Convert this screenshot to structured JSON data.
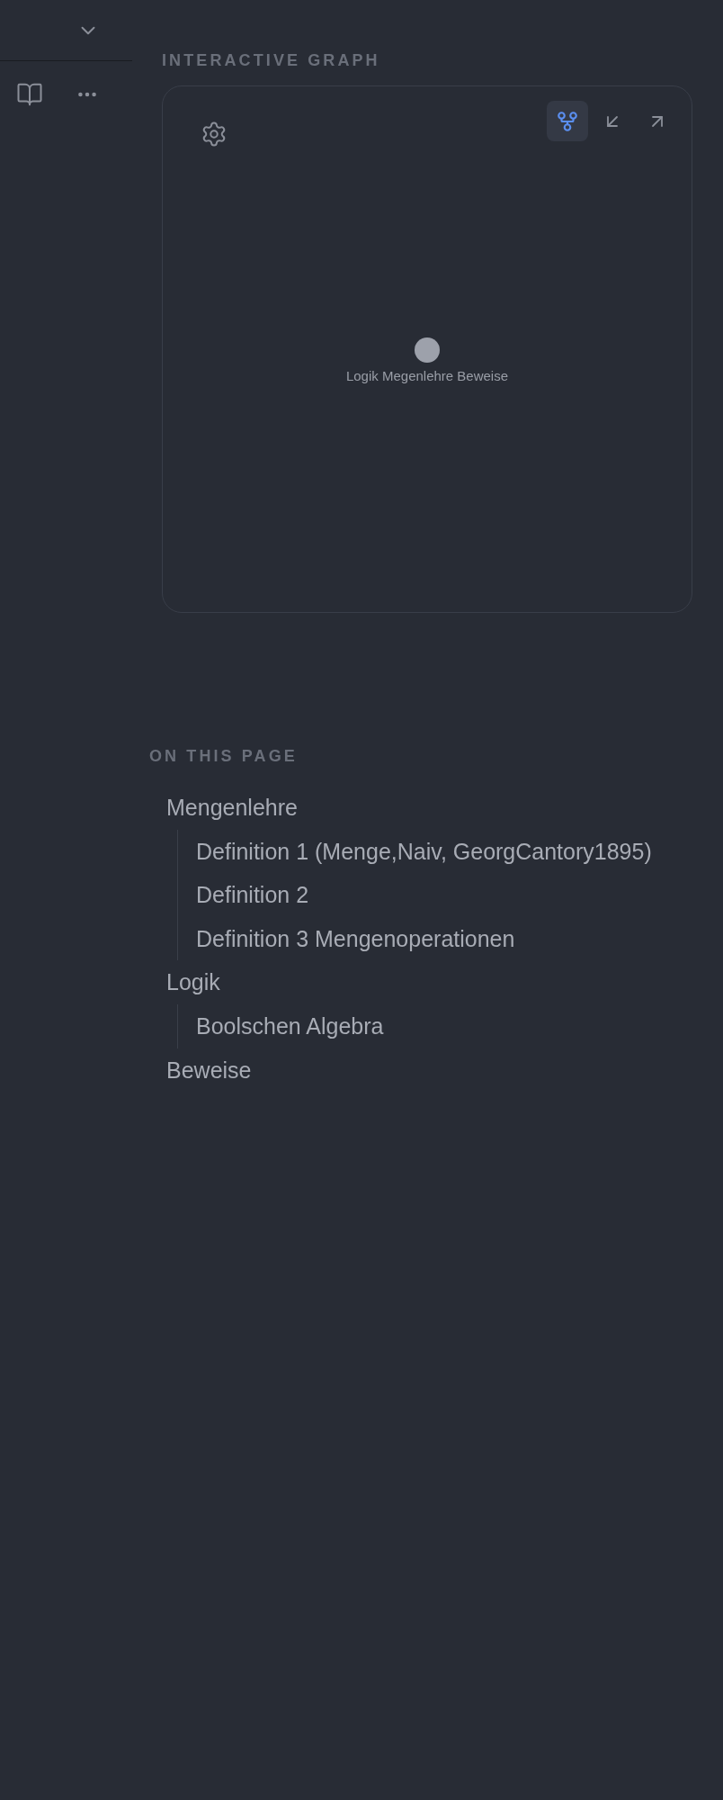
{
  "graph": {
    "title": "INTERACTIVE GRAPH",
    "controls": [
      {
        "kind": "graph",
        "selected": true
      },
      {
        "kind": "collapse",
        "selected": false
      },
      {
        "kind": "expand",
        "selected": false
      }
    ],
    "nodes": [
      {
        "label": "Logik Megenlehre Beweise"
      }
    ]
  },
  "outline": {
    "title": "ON THIS PAGE",
    "items": [
      {
        "label": "Mengenlehre",
        "children": [
          {
            "label": "Definition 1 (Menge,Naiv, GeorgCantory1895)"
          },
          {
            "label": "Definition 2"
          },
          {
            "label": "Definition 3 Mengenoperationen"
          }
        ]
      },
      {
        "label": "Logik",
        "children": [
          {
            "label": "Boolschen Algebra"
          }
        ]
      },
      {
        "label": "Beweise"
      }
    ]
  }
}
